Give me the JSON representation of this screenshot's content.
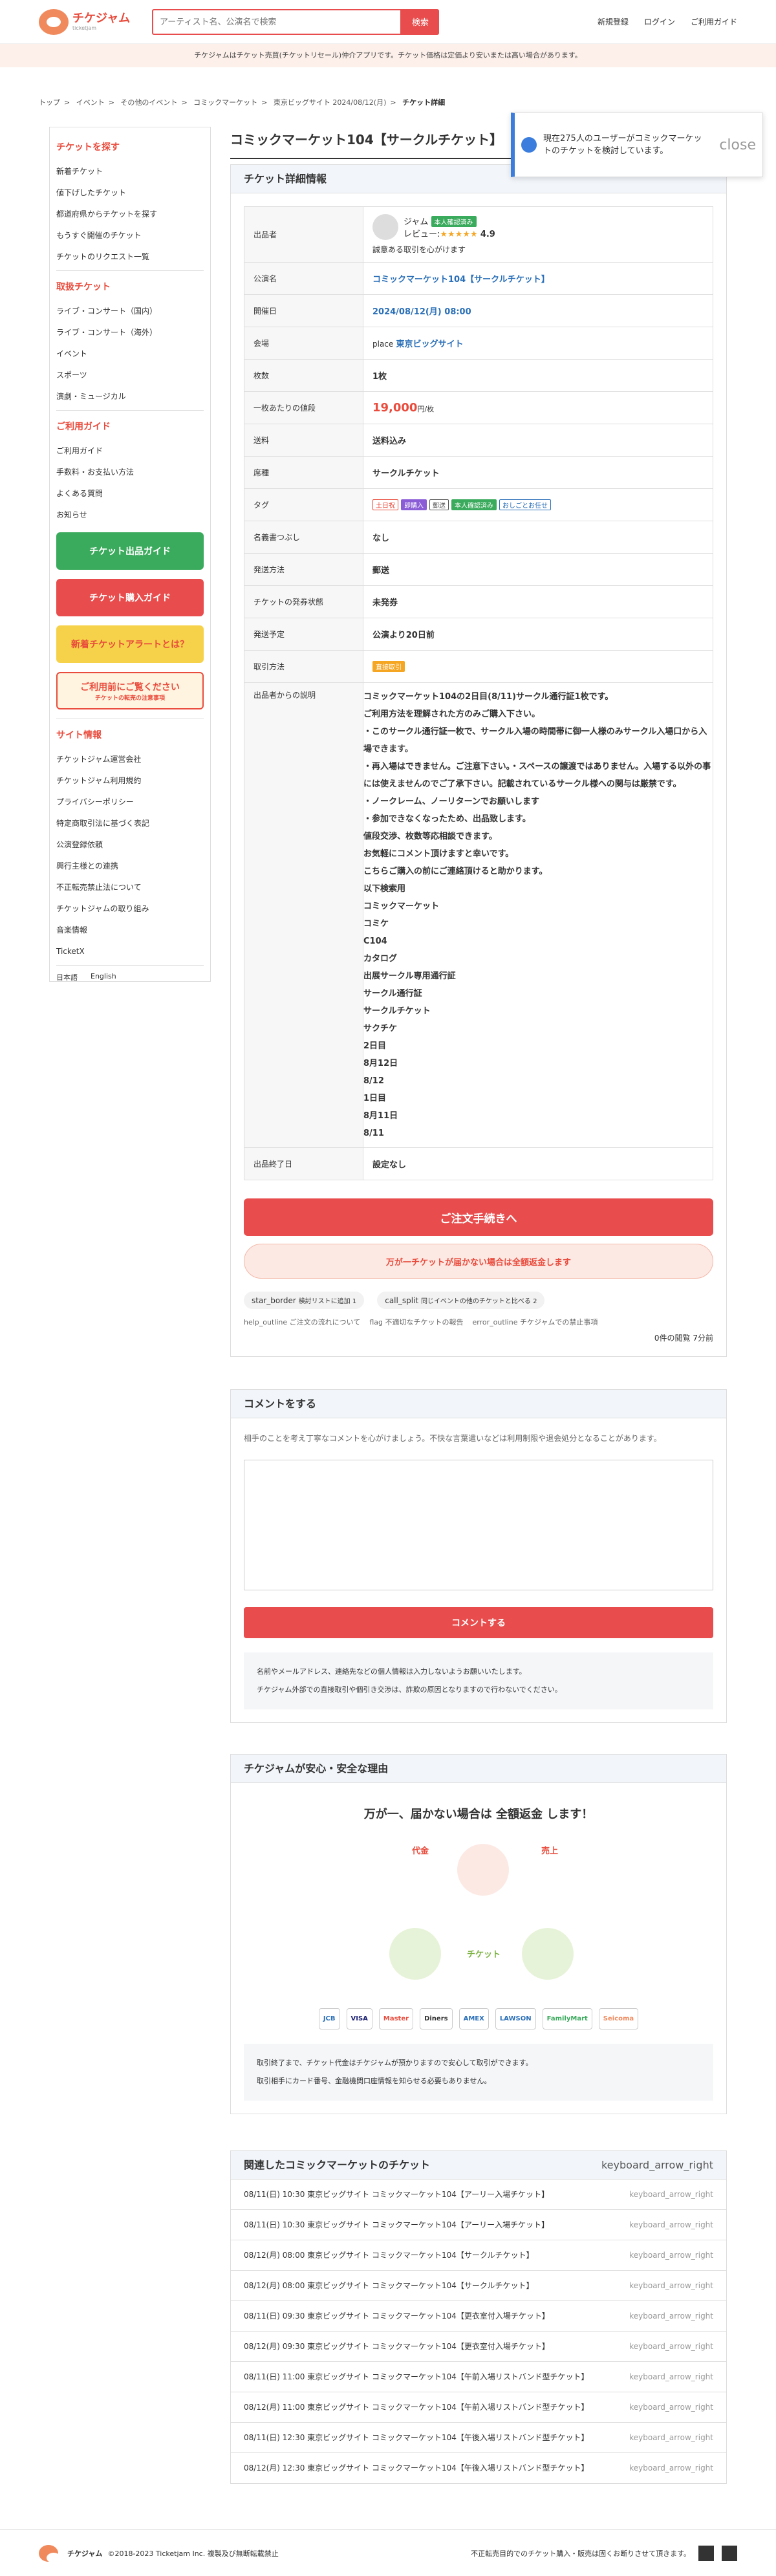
{
  "header": {
    "logo": "チケジャム",
    "logo_sub": "ticketjam",
    "search_placeholder": "アーティスト名、公演名で検索",
    "search_btn": "検索",
    "nav": [
      "新規登録",
      "ログイン",
      "ご利用ガイド"
    ]
  },
  "notice": "チケジャムはチケット売買(チケットリセール)仲介アプリです。チケット価格は定価より安いまたは高い場合があります。",
  "breadcrumb": [
    "トップ",
    "イベント",
    "その他のイベント",
    "コミックマーケット",
    "東京ビッグサイト 2024/08/12(月)",
    "チケット詳細"
  ],
  "sidebar": {
    "find_title": "チケットを探す",
    "find": [
      "新着チケット",
      "値下げしたチケット",
      "都道府県からチケットを探す",
      "もうすぐ開催のチケット",
      "チケットのリクエスト一覧"
    ],
    "cat_title": "取扱チケット",
    "cats": [
      "ライブ・コンサート（国内）",
      "ライブ・コンサート（海外）",
      "イベント",
      "スポーツ",
      "演劇・ミュージカル"
    ],
    "guide_title": "ご利用ガイド",
    "guides": [
      "ご利用ガイド",
      "手数料・お支払い方法",
      "よくある質問",
      "お知らせ"
    ],
    "banners": [
      "チケット出品ガイド",
      "チケット購入ガイド",
      "新着チケットアラートとは？",
      "ご利用前にご覧ください"
    ],
    "banner_sub": "チケットの転売の注意事項",
    "info_title": "サイト情報",
    "info": [
      "チケットジャム運営会社",
      "チケットジャム利用規約",
      "プライバシーポリシー",
      "特定商取引法に基づく表記",
      "公演登録依頼",
      "興行主様との連携",
      "不正転売禁止法について",
      "チケットジャムの取り組み",
      "音楽情報",
      "TicketX"
    ],
    "langs": [
      "日本語",
      "English"
    ]
  },
  "main": {
    "title": "コミックマーケット104【サークルチケット】",
    "toast": "現在275人のユーザーがコミックマーケットのチケットを検討しています。",
    "toast_close": "close",
    "detail_title": "チケット詳細情報",
    "rows": [
      {
        "k": "出品者",
        "seller": "ジャム",
        "badge": "本人確認済み",
        "review_label": "レビュー:",
        "review": "4.9",
        "note": "誠意ある取引を心がけます"
      },
      {
        "k": "公演名",
        "v": "コミックマーケット104【サークルチケット】"
      },
      {
        "k": "開催日",
        "v": "2024/08/12(月) 08:00"
      },
      {
        "k": "会場",
        "place": "place",
        "v": "東京ビッグサイト"
      },
      {
        "k": "枚数",
        "v": "1枚"
      },
      {
        "k": "一枚あたりの値段",
        "v": "19,000",
        "unit": "円/枚"
      },
      {
        "k": "送料",
        "v": "送料込み"
      },
      {
        "k": "席種",
        "v": "サークルチケット"
      },
      {
        "k": "タグ",
        "tags": [
          "土日祝",
          "即購入",
          "郵送",
          "本人確認済み",
          "おしごとお任せ"
        ]
      },
      {
        "k": "名義書つぶし",
        "v": "なし"
      },
      {
        "k": "発送方法",
        "v": "郵送"
      },
      {
        "k": "チケットの発券状態",
        "v": "未発券"
      },
      {
        "k": "発送予定",
        "v": "公演より20日前"
      },
      {
        "k": "取引方法",
        "v": "直接取引"
      }
    ],
    "desc_k": "出品者からの説明",
    "desc": [
      "コミックマーケット104の2日目(8/11)サークル通行証1枚です。",
      "ご利用方法を理解された方のみご購入下さい。",
      "・このサークル通行証一枚で、サークル入場の時間帯に御一人様のみサークル入場口から入場できます。",
      "・再入場はできません。ご注意下さい。・スペースの譲渡ではありません。入場する以外の事には使えませんのでご了承下さい。記載されているサークル様への関与は厳禁です。",
      "・ノークレーム、ノーリターンでお願いします",
      "・参加できなくなったため、出品致します。",
      "値段交渉、枚数等応相談できます。",
      "お気軽にコメント頂けますと幸いです。",
      "こちらご購入の前にご連絡頂けると助かります。",
      "以下検索用",
      "コミックマーケット",
      "コミケ",
      "C104",
      "カタログ",
      "出展サークル専用通行証",
      "サークル通行証",
      "サークルチケット",
      "サクチケ",
      "2日目",
      "8月12日",
      "8/12",
      "1日目",
      "8月11日",
      "8/11"
    ],
    "end_k": "出品終了日",
    "end_v": "設定なし",
    "order_btn": "ご注文手続きへ",
    "refund_btn": "万が一チケットが届かない場合は全額返金します",
    "fav": "star_border",
    "fav_label": "検討リストに追加 1",
    "cmp": "call_split",
    "cmp_label": "同じイベントの他のチケットと比べる 2",
    "help": "help_outline",
    "help_label": "ご注文の流れについて",
    "flag": "flag",
    "flag_label": "不適切なチケットの報告",
    "err": "error_outline",
    "err_label": "チケジャムでの禁止事項",
    "views": "0件の閲覧",
    "ago": "7分前"
  },
  "comment": {
    "title": "コメントをする",
    "intro": "相手のことを考え丁寧なコメントを心がけましょう。不快な言葉遣いなどは利用制限や退会処分となることがあります。",
    "btn": "コメントする",
    "notes": [
      "名前やメールアドレス、連絡先などの個人情報は入力しないようお願いいたします。",
      "チケジャム外部での直接取引や個引き交渉は、詐欺の原因となりますので行わないでください。"
    ]
  },
  "safe": {
    "title": "チケジャムが安心・安全な理由",
    "head": "万が一、届かない場合は 全額返金 します！",
    "l1": "代金",
    "l2": "売上",
    "l3": "チケット",
    "pay": [
      "JCB",
      "VISA",
      "Master",
      "Diners",
      "AMEX",
      "LAWSON",
      "FamilyMart",
      "Seicoma"
    ],
    "notes": [
      "取引終了まで、チケット代金はチケジャムが預かりますので安心して取引ができます。",
      "取引相手にカード番号、金融機関口座情報を知らせる必要もありません。"
    ]
  },
  "related": {
    "title": "関連したコミックマーケットのチケット",
    "rows": [
      "08/11(日) 10:30 東京ビッグサイト コミックマーケット104【アーリー入場チケット】",
      "08/11(日) 10:30 東京ビッグサイト コミックマーケット104【アーリー入場チケット】",
      "08/12(月) 08:00 東京ビッグサイト コミックマーケット104【サークルチケット】",
      "08/12(月) 08:00 東京ビッグサイト コミックマーケット104【サークルチケット】",
      "08/11(日) 09:30 東京ビッグサイト コミックマーケット104【更衣室付入場チケット】",
      "08/12(月) 09:30 東京ビッグサイト コミックマーケット104【更衣室付入場チケット】",
      "08/11(日) 11:00 東京ビッグサイト コミックマーケット104【午前入場リストバンド型チケット】",
      "08/12(月) 11:00 東京ビッグサイト コミックマーケット104【午前入場リストバンド型チケット】",
      "08/11(日) 12:30 東京ビッグサイト コミックマーケット104【午後入場リストバンド型チケット】",
      "08/12(月) 12:30 東京ビッグサイト コミックマーケット104【午後入場リストバンド型チケット】"
    ],
    "arrow": "keyboard_arrow_right"
  },
  "footer": {
    "copy": "©2018-2023 Ticketjam Inc. 複製及び無断転載禁止",
    "right": "不正転売目的でのチケット購入・販売は固くお断りさせて頂きます。"
  }
}
